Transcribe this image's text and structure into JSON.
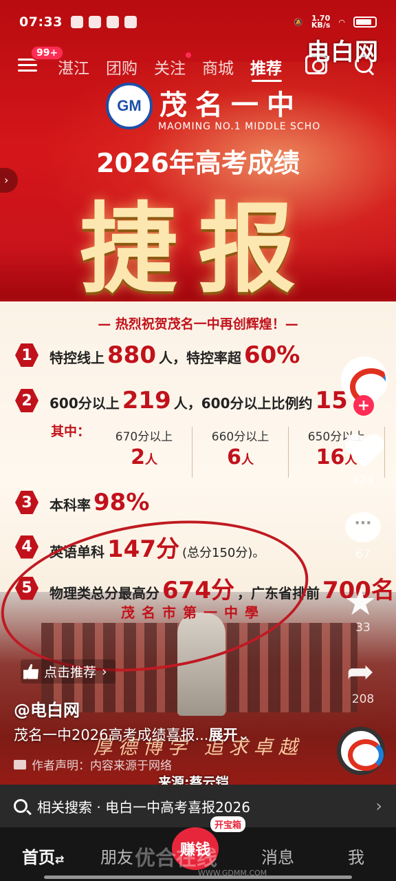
{
  "status_bar": {
    "time": "07:33",
    "net_speed": "1.70",
    "net_unit": "KB/s"
  },
  "nav": {
    "badge": "99+",
    "tabs": [
      "湛江",
      "团购",
      "关注",
      "商城",
      "推荐"
    ],
    "active_tab": "推荐",
    "watermark": "电白网"
  },
  "poster": {
    "logo_text": "GM",
    "school_name": "茂名一中",
    "school_en": "MAOMING NO.1 MIDDLE SCHO",
    "year_title": "2026年高考成绩",
    "big_title": "捷报",
    "congrats": "— 热烈祝贺茂名一中再创辉煌！—",
    "items": [
      {
        "no": "1",
        "pre": "特控线上",
        "v1": "880",
        "mid": "人，特控率超",
        "v2": "60%",
        "post": ""
      },
      {
        "no": "2",
        "pre": "600分以上",
        "v1": "219",
        "mid": "人，600分以上比例约",
        "v2": "15",
        "post": ""
      },
      {
        "no": "3",
        "pre": "本科率",
        "v1": "98%",
        "mid": "",
        "v2": "",
        "post": ""
      },
      {
        "no": "4",
        "pre": "英语单科",
        "v1": "147分",
        "mid": "",
        "v2": "",
        "post": "(总分150分)。"
      },
      {
        "no": "5",
        "pre": "物理类总分最高分",
        "v1": "674分",
        "mid": "，广东省排前",
        "v2": "700名",
        "post": ""
      }
    ],
    "sub_label": "其中：",
    "sub_table": [
      {
        "k": "670分以上",
        "v": "2",
        "u": "人"
      },
      {
        "k": "660分以上",
        "v": "6",
        "u": "人"
      },
      {
        "k": "650分以上",
        "v": "16",
        "u": "人"
      }
    ],
    "gate_text": "茂名市第一中學",
    "motto": "厚德博学 追求卓越"
  },
  "rail": {
    "follow": "+",
    "likes": "124",
    "comments": "67",
    "favorites": "33",
    "shares": "208"
  },
  "info": {
    "recommend": "点击推荐",
    "author": "@电白网",
    "desc": "茂名一中2026高考成绩喜报...",
    "expand": "展开",
    "declare": "作者声明：内容来源于网络",
    "source": "来源:蔡云铠"
  },
  "related": {
    "label": "相关搜索 · 电白一中高考喜报2026"
  },
  "bottom_nav": {
    "home": "首页",
    "friends": "朋友",
    "earn": "赚钱",
    "treasure": "开宝箱",
    "messages": "消息",
    "me": "我",
    "watermark": "优合在线",
    "watermark_sub": "WWW.GDMM.COM"
  }
}
